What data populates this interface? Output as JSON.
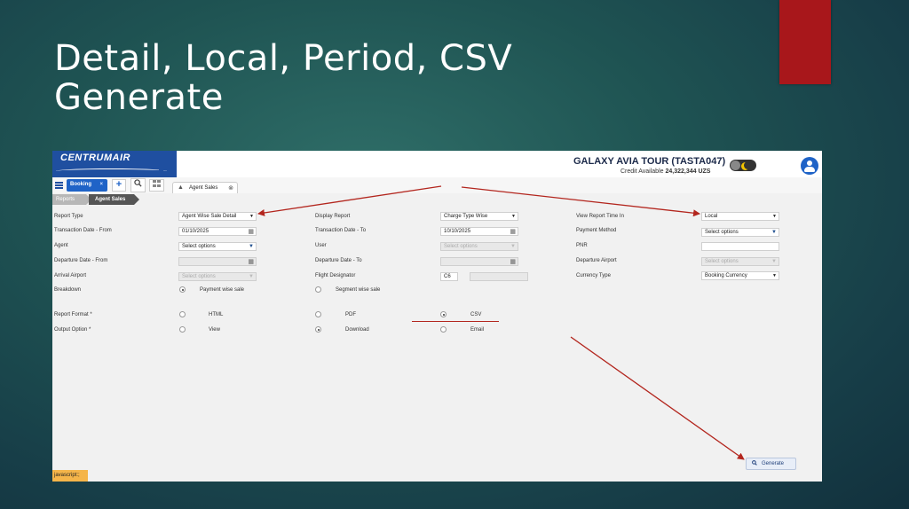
{
  "slide": {
    "title_line1": "Detail, Local, Period, CSV",
    "title_line2": "Generate"
  },
  "header": {
    "logo": "CENTRUMAIR",
    "agency": "GALAXY AVIA TOUR (TASTA047)",
    "credit_label": "Credit Available",
    "credit_value": "24,322,344 UZS"
  },
  "toolbar": {
    "booking": "Booking",
    "booking_close": "×",
    "plus": "+",
    "tab": "Agent Sales",
    "tab_close": "⊗"
  },
  "breadcrumb": {
    "reports": "Reports",
    "agent_sales": "Agent Sales"
  },
  "form": {
    "report_type_label": "Report Type",
    "report_type_value": "Agent Wise Sale Detail",
    "display_report_label": "Display Report",
    "display_report_value": "Charge Type Wise",
    "view_time_label": "View Report Time In",
    "view_time_value": "Local",
    "trx_from_label": "Transaction Date - From",
    "trx_from_value": "01/10/2025",
    "trx_to_label": "Transaction Date - To",
    "trx_to_value": "10/10/2025",
    "payment_method_label": "Payment Method",
    "payment_method_value": "Select options",
    "agent_label": "Agent",
    "agent_value": "Select options",
    "user_label": "User",
    "user_value": "Select options",
    "pnr_label": "PNR",
    "pnr_value": "",
    "dep_from_label": "Departure Date - From",
    "dep_from_value": "",
    "dep_to_label": "Departure Date - To",
    "dep_to_value": "",
    "dep_airport_label": "Departure Airport",
    "dep_airport_value": "Select options",
    "arr_airport_label": "Arrival Airport",
    "arr_airport_value": "Select options",
    "flight_designator_label": "Flight Designator",
    "flight_designator_value": "C6",
    "currency_type_label": "Currency Type",
    "currency_type_value": "Booking Currency",
    "breakdown_label": "Breakdown",
    "breakdown_opt1": "Payment wise sale",
    "breakdown_opt2": "Segment wise sale",
    "report_format_label": "Report Format *",
    "format_html": "HTML",
    "format_pdf": "PDF",
    "format_csv": "CSV",
    "output_option_label": "Output Option *",
    "output_view": "View",
    "output_download": "Download",
    "output_email": "Email"
  },
  "actions": {
    "generate": "Generate"
  },
  "status": {
    "js": "javascript:;"
  },
  "colors": {
    "accent_red": "#a8171b",
    "brand_blue": "#1f4fa0",
    "arrow_red": "#b3261e"
  }
}
